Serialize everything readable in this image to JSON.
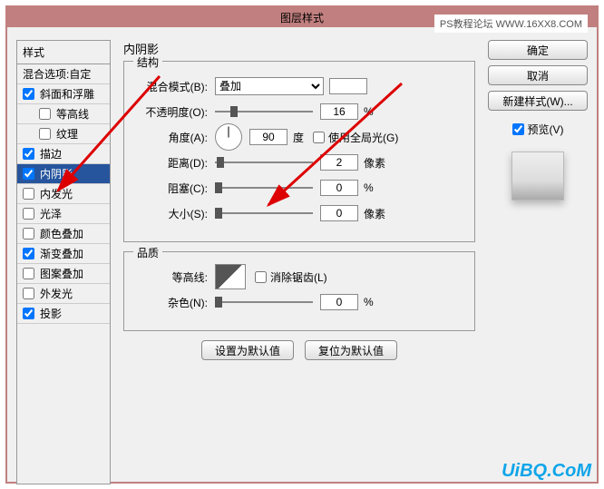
{
  "window": {
    "title": "图层样式"
  },
  "watermark": {
    "top": "PS教程论坛 WWW.16XX8.COM",
    "bottom": "UiBQ.CoM"
  },
  "left": {
    "header": "样式",
    "blend_opts": "混合选项:自定",
    "items": [
      {
        "label": "斜面和浮雕",
        "checked": true,
        "indent": false,
        "sel": false
      },
      {
        "label": "等高线",
        "checked": false,
        "indent": true,
        "sel": false
      },
      {
        "label": "纹理",
        "checked": false,
        "indent": true,
        "sel": false
      },
      {
        "label": "描边",
        "checked": true,
        "indent": false,
        "sel": false
      },
      {
        "label": "内阴影",
        "checked": true,
        "indent": false,
        "sel": true
      },
      {
        "label": "内发光",
        "checked": false,
        "indent": false,
        "sel": false
      },
      {
        "label": "光泽",
        "checked": false,
        "indent": false,
        "sel": false
      },
      {
        "label": "颜色叠加",
        "checked": false,
        "indent": false,
        "sel": false
      },
      {
        "label": "渐变叠加",
        "checked": true,
        "indent": false,
        "sel": false
      },
      {
        "label": "图案叠加",
        "checked": false,
        "indent": false,
        "sel": false
      },
      {
        "label": "外发光",
        "checked": false,
        "indent": false,
        "sel": false
      },
      {
        "label": "投影",
        "checked": true,
        "indent": false,
        "sel": false
      }
    ]
  },
  "center": {
    "title": "内阴影",
    "structure": {
      "legend": "结构",
      "blend_mode_label": "混合模式(B):",
      "blend_mode_value": "叠加",
      "opacity_label": "不透明度(O):",
      "opacity_value": "16",
      "opacity_unit": "%",
      "angle_label": "角度(A):",
      "angle_value": "90",
      "angle_unit": "度",
      "global_light_label": "使用全局光(G)",
      "distance_label": "距离(D):",
      "distance_value": "2",
      "distance_unit": "像素",
      "choke_label": "阻塞(C):",
      "choke_value": "0",
      "choke_unit": "%",
      "size_label": "大小(S):",
      "size_value": "0",
      "size_unit": "像素"
    },
    "quality": {
      "legend": "品质",
      "contour_label": "等高线:",
      "antialias_label": "消除锯齿(L)",
      "noise_label": "杂色(N):",
      "noise_value": "0",
      "noise_unit": "%"
    },
    "buttons": {
      "default": "设置为默认值",
      "reset": "复位为默认值"
    }
  },
  "right": {
    "ok": "确定",
    "cancel": "取消",
    "new_style": "新建样式(W)...",
    "preview": "预览(V)"
  }
}
